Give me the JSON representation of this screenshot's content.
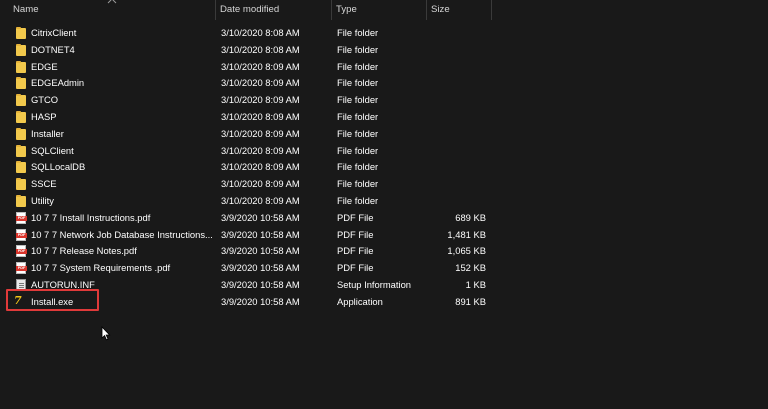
{
  "columns": {
    "name": "Name",
    "date_modified": "Date modified",
    "type": "Type",
    "size": "Size"
  },
  "rows": [
    {
      "icon": "folder-icon",
      "name": "CitrixClient",
      "date": "3/10/2020 8:08 AM",
      "type": "File folder",
      "size": ""
    },
    {
      "icon": "folder-icon",
      "name": "DOTNET4",
      "date": "3/10/2020 8:08 AM",
      "type": "File folder",
      "size": ""
    },
    {
      "icon": "folder-icon",
      "name": "EDGE",
      "date": "3/10/2020 8:09 AM",
      "type": "File folder",
      "size": ""
    },
    {
      "icon": "folder-icon",
      "name": "EDGEAdmin",
      "date": "3/10/2020 8:09 AM",
      "type": "File folder",
      "size": ""
    },
    {
      "icon": "folder-icon",
      "name": "GTCO",
      "date": "3/10/2020 8:09 AM",
      "type": "File folder",
      "size": ""
    },
    {
      "icon": "folder-icon",
      "name": "HASP",
      "date": "3/10/2020 8:09 AM",
      "type": "File folder",
      "size": ""
    },
    {
      "icon": "folder-icon",
      "name": "Installer",
      "date": "3/10/2020 8:09 AM",
      "type": "File folder",
      "size": ""
    },
    {
      "icon": "folder-icon",
      "name": "SQLClient",
      "date": "3/10/2020 8:09 AM",
      "type": "File folder",
      "size": ""
    },
    {
      "icon": "folder-icon",
      "name": "SQLLocalDB",
      "date": "3/10/2020 8:09 AM",
      "type": "File folder",
      "size": ""
    },
    {
      "icon": "folder-icon",
      "name": "SSCE",
      "date": "3/10/2020 8:09 AM",
      "type": "File folder",
      "size": ""
    },
    {
      "icon": "folder-icon",
      "name": "Utility",
      "date": "3/10/2020 8:09 AM",
      "type": "File folder",
      "size": ""
    },
    {
      "icon": "pdf-icon",
      "name": "10 7 7 Install Instructions.pdf",
      "date": "3/9/2020 10:58 AM",
      "type": "PDF File",
      "size": "689 KB"
    },
    {
      "icon": "pdf-icon",
      "name": "10 7 7 Network Job Database Instructions...",
      "date": "3/9/2020 10:58 AM",
      "type": "PDF File",
      "size": "1,481 KB"
    },
    {
      "icon": "pdf-icon",
      "name": "10 7 7 Release Notes.pdf",
      "date": "3/9/2020 10:58 AM",
      "type": "PDF File",
      "size": "1,065 KB"
    },
    {
      "icon": "pdf-icon",
      "name": "10 7 7 System Requirements .pdf",
      "date": "3/9/2020 10:58 AM",
      "type": "PDF File",
      "size": "152 KB"
    },
    {
      "icon": "inf-file-icon",
      "name": "AUTORUN.INF",
      "date": "3/9/2020 10:58 AM",
      "type": "Setup Information",
      "size": "1 KB"
    },
    {
      "icon": "application-icon",
      "name": "Install.exe",
      "date": "3/9/2020 10:58 AM",
      "type": "Application",
      "size": "891 KB"
    }
  ],
  "highlight_color": "#e03a3a",
  "exe_icon_glyph": "7"
}
